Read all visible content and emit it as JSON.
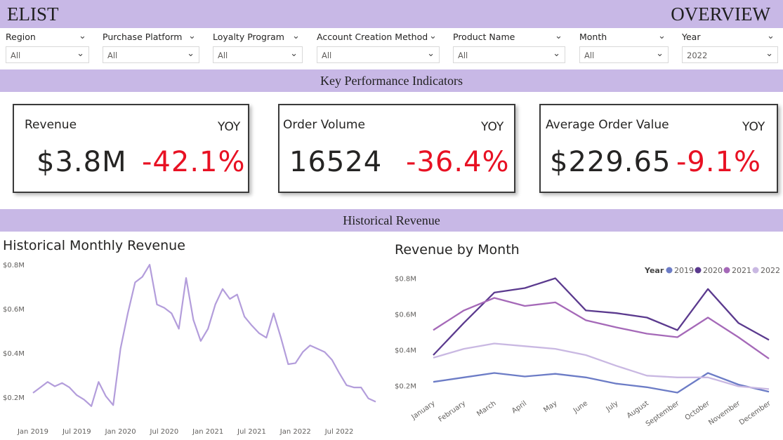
{
  "header": {
    "brand": "ELIST",
    "page": "OVERVIEW"
  },
  "filters": [
    {
      "label": "Region",
      "value": "All"
    },
    {
      "label": "Purchase Platform",
      "value": "All"
    },
    {
      "label": "Loyalty Program",
      "value": "All"
    },
    {
      "label": "Account Creation Method",
      "value": "All"
    },
    {
      "label": "Product Name",
      "value": "All"
    },
    {
      "label": "Month",
      "value": "All"
    },
    {
      "label": "Year",
      "value": "2022"
    }
  ],
  "sections": {
    "kpi": "Key Performance Indicators",
    "history": "Historical Revenue"
  },
  "kpis": [
    {
      "title": "Revenue",
      "yoy_label": "YOY",
      "value": "$3.8M",
      "yoy": "-42.1%"
    },
    {
      "title": "Order Volume",
      "yoy_label": "YOY",
      "value": "16524",
      "yoy": "-36.4%"
    },
    {
      "title": "Average Order Value",
      "yoy_label": "YOY",
      "value": "$229.65",
      "yoy": "-9.1%"
    }
  ],
  "colors": {
    "accent_band": "#c8b8e6",
    "negative": "#e81123",
    "line_hist": "#b39ddb"
  },
  "chart_data": [
    {
      "type": "line",
      "title": "Historical Monthly Revenue",
      "xlabel": "",
      "ylabel": "",
      "x": [
        "Jan 2019",
        "Feb 2019",
        "Mar 2019",
        "Apr 2019",
        "May 2019",
        "Jun 2019",
        "Jul 2019",
        "Aug 2019",
        "Sep 2019",
        "Oct 2019",
        "Nov 2019",
        "Dec 2019",
        "Jan 2020",
        "Feb 2020",
        "Mar 2020",
        "Apr 2020",
        "May 2020",
        "Jun 2020",
        "Jul 2020",
        "Aug 2020",
        "Sep 2020",
        "Oct 2020",
        "Nov 2020",
        "Dec 2020",
        "Jan 2021",
        "Feb 2021",
        "Mar 2021",
        "Apr 2021",
        "May 2021",
        "Jun 2021",
        "Jul 2021",
        "Aug 2021",
        "Sep 2021",
        "Oct 2021",
        "Nov 2021",
        "Dec 2021",
        "Jan 2022",
        "Feb 2022",
        "Mar 2022",
        "Apr 2022",
        "May 2022",
        "Jun 2022",
        "Jul 2022",
        "Aug 2022",
        "Sep 2022",
        "Oct 2022",
        "Nov 2022",
        "Dec 2022"
      ],
      "x_tick_labels": [
        "Jan 2019",
        "Jul 2019",
        "Jan 2020",
        "Jul 2020",
        "Jan 2021",
        "Jul 2021",
        "Jan 2022",
        "Jul 2022"
      ],
      "x_tick_index": [
        0,
        6,
        12,
        18,
        24,
        30,
        36,
        42
      ],
      "series": [
        {
          "values": [
            0.22,
            0.245,
            0.27,
            0.25,
            0.265,
            0.245,
            0.21,
            0.19,
            0.16,
            0.27,
            0.205,
            0.165,
            0.42,
            0.58,
            0.72,
            0.745,
            0.8,
            0.62,
            0.605,
            0.58,
            0.51,
            0.74,
            0.55,
            0.455,
            0.51,
            0.62,
            0.69,
            0.645,
            0.665,
            0.565,
            0.525,
            0.49,
            0.47,
            0.58,
            0.47,
            0.35,
            0.355,
            0.405,
            0.435,
            0.42,
            0.405,
            0.37,
            0.31,
            0.255,
            0.245,
            0.245,
            0.195,
            0.18
          ]
        }
      ],
      "y_tick_labels": [
        "$0.2M",
        "$0.4M",
        "$0.6M",
        "$0.8M"
      ],
      "y_ticks": [
        0.2,
        0.4,
        0.6,
        0.8
      ],
      "ylim": [
        0.15,
        0.81
      ],
      "grid": false
    },
    {
      "type": "line",
      "title": "Revenue by Month",
      "xlabel": "",
      "ylabel": "",
      "legend_title": "Year",
      "legend_position": "top-right",
      "categories": [
        "January",
        "February",
        "March",
        "April",
        "May",
        "June",
        "July",
        "August",
        "September",
        "October",
        "November",
        "December"
      ],
      "series": [
        {
          "name": "2019",
          "color": "#6c7cc6",
          "values": [
            0.22,
            0.245,
            0.27,
            0.25,
            0.265,
            0.245,
            0.21,
            0.19,
            0.16,
            0.27,
            0.205,
            0.165
          ]
        },
        {
          "name": "2020",
          "color": "#5b3a8e",
          "values": [
            0.37,
            0.55,
            0.72,
            0.745,
            0.8,
            0.62,
            0.605,
            0.58,
            0.51,
            0.74,
            0.55,
            0.455
          ]
        },
        {
          "name": "2021",
          "color": "#a569b8",
          "values": [
            0.51,
            0.62,
            0.69,
            0.645,
            0.665,
            0.565,
            0.525,
            0.49,
            0.47,
            0.58,
            0.47,
            0.35
          ]
        },
        {
          "name": "2022",
          "color": "#c9b8e2",
          "values": [
            0.355,
            0.405,
            0.435,
            0.42,
            0.405,
            0.37,
            0.31,
            0.255,
            0.245,
            0.245,
            0.195,
            0.18
          ]
        }
      ],
      "y_tick_labels": [
        "$0.2M",
        "$0.4M",
        "$0.6M",
        "$0.8M"
      ],
      "y_ticks": [
        0.2,
        0.4,
        0.6,
        0.8
      ],
      "ylim": [
        0.15,
        0.81
      ],
      "grid": false
    }
  ]
}
